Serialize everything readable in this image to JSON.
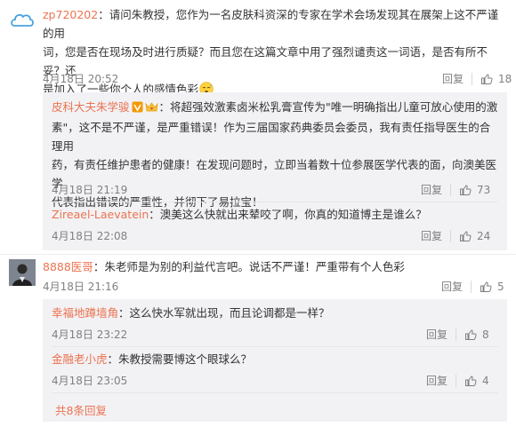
{
  "c1": {
    "user": "zp720202",
    "line1": "：请问朱教授，您作为一名皮肤科资深的专家在学术会场发现其在展架上这不严谨的用",
    "line2": "词，您是否在现场及时进行质疑？而且您在这篇文章中用了强烈谴责这一词语，是否有所不妥？还",
    "line3": "是加入了一些你个人的感情色彩",
    "time": "4月18日 20:52",
    "reply": "回复",
    "likes": "18"
  },
  "r1": {
    "user": "皮科大夫朱学骏",
    "line1": "：将超强效激素卤米松乳膏宣传为\"唯一明确指出儿童可放心使用的激",
    "line2": "素\"，这不是不严谨，是严重错误！作为三届国家药典委员会委员，我有责任指导医生的合理用",
    "line3": "药，有责任维护患者的健康！在发现问题时，立即当着数十位参展医学代表的面，向澳美医学",
    "line4": "代表指出错误的严重性，并彻下了易拉宝！",
    "time": "4月18日 21:19",
    "reply": "回复",
    "likes": "73"
  },
  "r2": {
    "user": "Zireael-Laevatein",
    "text": "：澳美这么快就出来辇咬了啊，你真的知道博主是谁么？",
    "time": "4月18日 22:08",
    "reply": "回复",
    "likes": "24"
  },
  "c2": {
    "user": "8888医哥",
    "text": "：朱老师是为别的利益代言吧。说话不严谨！严重带有个人色彩",
    "time": "4月18日 21:16",
    "reply": "回复",
    "likes": "5"
  },
  "r3": {
    "user": "幸福地蹲墙角",
    "text": "：这么快水军就出现，而且论调都是一样？",
    "time": "4月18日 23:22",
    "reply": "回复",
    "likes": "8"
  },
  "r4": {
    "user": "金融老小虎",
    "text": "：朱教授需要博这个眼球么？",
    "time": "4月18日 23:05",
    "reply": "回复",
    "likes": "4"
  },
  "more": "共8条回复",
  "colors": {
    "link": "#eb7350",
    "reply_bg": "#f2f2f5",
    "verify": "#f39800"
  },
  "icons": [
    "thumb-up-icon",
    "verified-badge-icon",
    "vip-crown-icon",
    "sleepy-emoji-icon"
  ]
}
